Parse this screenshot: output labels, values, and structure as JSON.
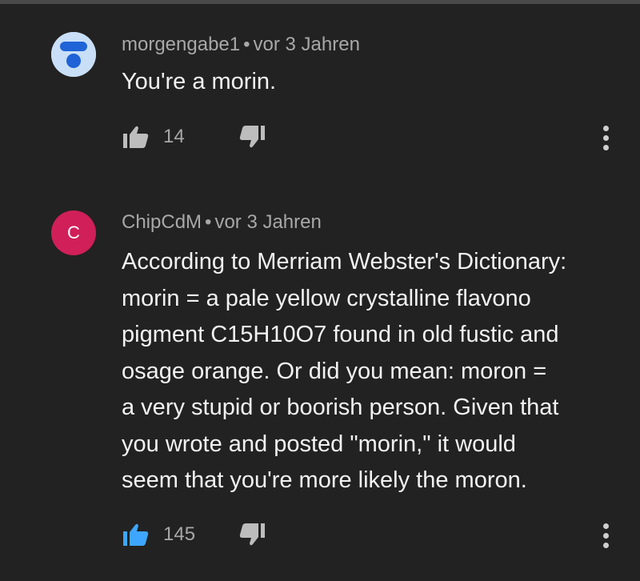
{
  "comments": [
    {
      "author": "morgengabe1",
      "separator": "•",
      "time": "vor 3 Jahren",
      "lines": [
        "You're a morin."
      ],
      "likes": "14",
      "liked": false,
      "avatar_color": "#c9dff7",
      "avatar_icon": "person-icon"
    },
    {
      "author": "ChipCdM",
      "separator": "•",
      "time": "vor 3 Jahren",
      "avatar_letter": "C",
      "avatar_color": "#d01f59",
      "lines": [
        "According to Merriam Webster's Dictionary:",
        "morin =  a pale yellow crystalline flavono",
        "pigment C15H10O7 found in old fustic and",
        "osage orange. Or did you mean: moron =",
        "a very stupid or boorish person. Given that",
        "you wrote and posted \"morin,\" it would",
        "seem that you're more likely the moron."
      ],
      "likes": "145",
      "liked": true
    }
  ],
  "colors": {
    "background": "#222222",
    "text": "#f2f2f2",
    "meta": "#a8a8a8",
    "icon": "#bdbdbd",
    "like_active": "#3ea6ff"
  }
}
